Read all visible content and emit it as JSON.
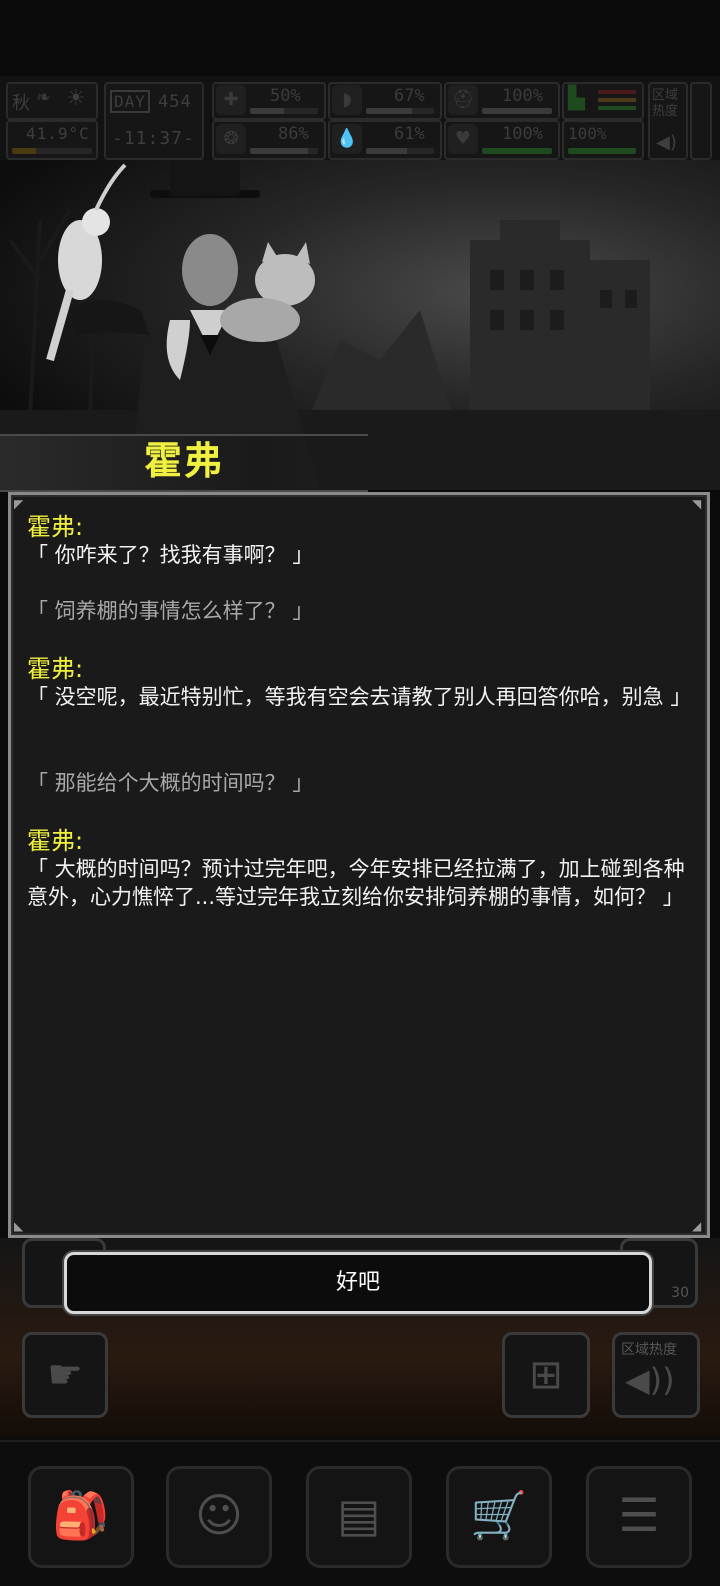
{
  "hud": {
    "season": "秋",
    "temperature": "41.9°C",
    "day_label": "DAY",
    "day_number": "454",
    "time": "-11:37-",
    "stats": [
      {
        "name": "health",
        "icon": "medkit-icon",
        "percent": "50%",
        "level": 0.5
      },
      {
        "name": "hunger",
        "icon": "stomach-icon",
        "percent": "67%",
        "level": 0.67
      },
      {
        "name": "armor",
        "icon": "helmet-icon",
        "percent": "100%",
        "level": 1.0
      },
      {
        "name": "mental",
        "icon": "brain-icon",
        "percent": "86%",
        "level": 0.86
      },
      {
        "name": "thirst",
        "icon": "water-drop-icon",
        "percent": "61%",
        "level": 0.61
      },
      {
        "name": "heart",
        "icon": "heart-icon",
        "percent": "100%",
        "level": 1.0
      },
      {
        "name": "stamina",
        "icon": "boot-icon",
        "percent": "100%",
        "level": 1.0
      }
    ],
    "zone_heat_label": "区域热度"
  },
  "npc": {
    "name": "霍弗"
  },
  "dialog": {
    "lines": [
      {
        "speaker": "霍弗:",
        "text": "「 你咋来了？找我有事啊？ 」"
      },
      {
        "speaker": "",
        "text": "「 饲养棚的事情怎么样了？ 」"
      },
      {
        "speaker": "霍弗:",
        "text": "「 没空呢，最近特别忙，等我有空会去请教了别人再回答你哈，别急 」"
      },
      {
        "speaker": "",
        "text": "「 那能给个大概的时间吗？ 」"
      },
      {
        "speaker": "霍弗:",
        "text": "「 大概的时间吗？预计过完年吧，今年安排已经拉满了，加上碰到各种意外，心力憔悴了...等过完年我立刻给你安排饲养棚的事情，如何？ 」"
      }
    ]
  },
  "button": {
    "ok_label": "好吧"
  },
  "under": {
    "zone_heat_label": "区域热度",
    "timer": "30"
  },
  "nav": [
    {
      "name": "backpack",
      "icon": "backpack-icon"
    },
    {
      "name": "skills",
      "icon": "brain-head-icon"
    },
    {
      "name": "journal",
      "icon": "notebook-icon"
    },
    {
      "name": "shop",
      "icon": "cart-icon"
    },
    {
      "name": "menu",
      "icon": "menu-icon"
    }
  ],
  "colors": {
    "speaker": "#f0f040",
    "npc_text": "#f2f2f2",
    "player_text": "#a8a8a8",
    "dialog_bg": "#1a1a1a",
    "button_border": "#d8d8d8"
  }
}
